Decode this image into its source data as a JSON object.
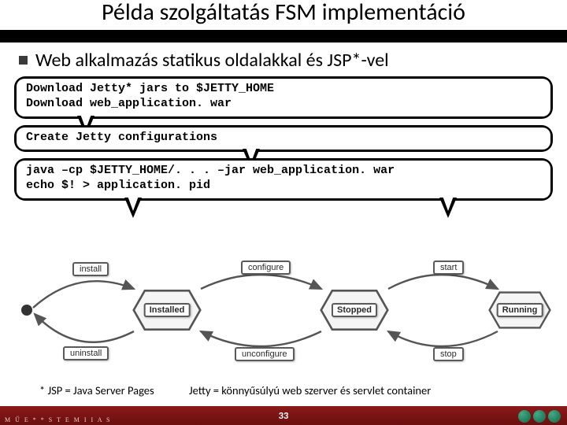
{
  "title": "Példa szolgáltatás FSM implementáció",
  "bullet": "Web alkalmazás statikus oldalakkal és JSP*-vel",
  "bubbles": {
    "b1": "Download Jetty* jars to $JETTY_HOME\nDownload web_application. war",
    "b2": "Create Jetty configurations",
    "b3": "java –cp $JETTY_HOME/. . . –jar web_application. war\necho $! > application. pid"
  },
  "states": {
    "installed": "Installed",
    "stopped": "Stopped",
    "running": "Running"
  },
  "transitions": {
    "install": "install",
    "uninstall": "uninstall",
    "configure": "configure",
    "unconfigure": "unconfigure",
    "start": "start",
    "stop": "stop"
  },
  "footnote_left": "* JSP = Java Server Pages",
  "footnote_right": "Jetty = könnyűsúlyú web szerver és servlet container",
  "page_number": "33",
  "footer_left": "M Ű E * * S T E M  I I A S"
}
